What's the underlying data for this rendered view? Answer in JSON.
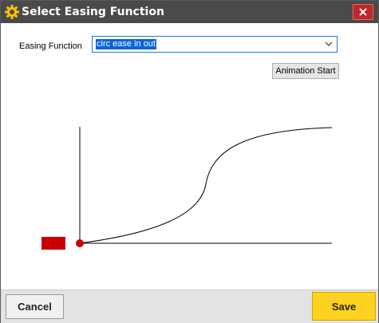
{
  "window": {
    "title": "Select Easing Function"
  },
  "form": {
    "easing_label": "Easing Function",
    "easing_value": "circ ease in out",
    "animation_start_label": "Animation Start"
  },
  "footer": {
    "cancel_label": "Cancel",
    "save_label": "Save"
  },
  "colors": {
    "titlebar": "#4a4a4a",
    "close_button": "#c0262b",
    "selection": "#0a64d6",
    "marker": "#cc0000",
    "save_button": "#ffd21f"
  },
  "icons": {
    "title": "gear-icon",
    "close": "close-icon",
    "dropdown": "chevron-down-icon"
  }
}
